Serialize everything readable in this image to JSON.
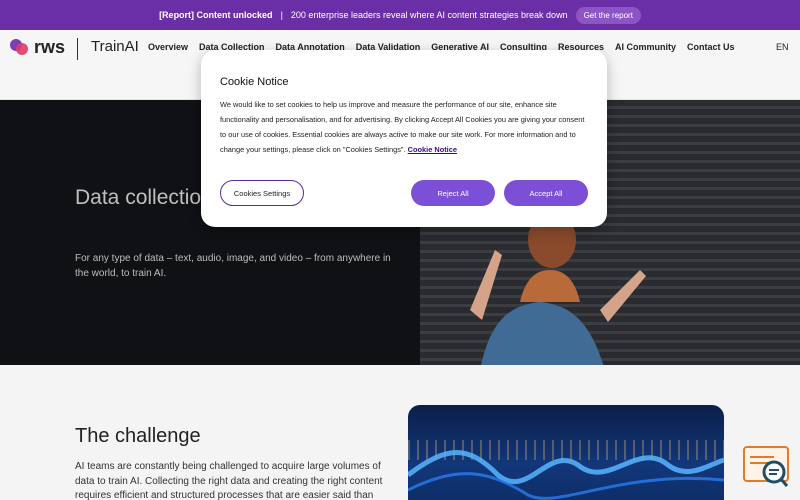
{
  "promo": {
    "tag": "[Report] Content unlocked",
    "separator": "|",
    "text": "200 enterprise leaders reveal where AI content strategies break down",
    "cta": "Get the report"
  },
  "nav": {
    "brand": "rws",
    "product": "TrainAI",
    "items": [
      "Overview",
      "Data Collection",
      "Data Annotation",
      "Data Validation",
      "Generative AI",
      "Consulting",
      "Resources",
      "AI Community",
      "Contact Us"
    ],
    "lang": "EN"
  },
  "hero": {
    "title": "Data collection and data generation",
    "subtitle": "For any type of data – text, audio, image, and video – from anywhere in the world, to train AI."
  },
  "challenge": {
    "title": "The challenge",
    "body": "AI teams are constantly being challenged to acquire large volumes of data to train AI. Collecting the right data and creating the right content requires efficient and structured processes that are easier said than"
  },
  "cookie": {
    "title": "Cookie Notice",
    "body": "We would like to set cookies to help us improve and measure the performance of our site, enhance site functionality and personalisation, and for advertising. By clicking Accept All Cookies you are giving your consent to our use of cookies. Essential cookies are always active to make our site work. For more information and to change your settings, please click on \"Cookies Settings\".",
    "link": "Cookie Notice",
    "settings": "Cookies Settings",
    "reject": "Reject All",
    "accept": "Accept All"
  },
  "colors": {
    "promo_bg": "#6a2fa6",
    "accent": "#7b4fd6",
    "hero_bg": "#101114"
  },
  "icons": {
    "logo": "rws-logo-icon",
    "widget": "search-document-icon"
  }
}
